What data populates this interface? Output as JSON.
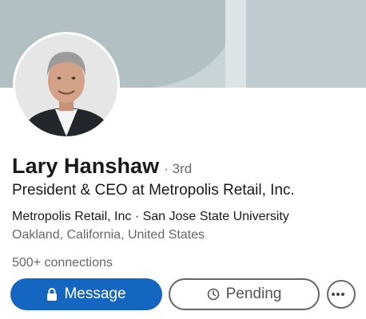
{
  "profile": {
    "name": "Lary Hanshaw",
    "degree": "· 3rd",
    "headline": "President & CEO at Metropolis Retail, Inc.",
    "company_line": "Metropolis Retail, Inc · San Jose State University",
    "location": "Oakland, California, United States",
    "connections": "500+ connections"
  },
  "actions": {
    "message_label": "Message",
    "pending_label": "Pending",
    "more_label": "···"
  },
  "colors": {
    "primary": "#1566c0",
    "text": "#191919",
    "muted": "#666666"
  },
  "icons": {
    "message": "lock-icon",
    "pending": "clock-icon",
    "more": "ellipsis-icon"
  }
}
